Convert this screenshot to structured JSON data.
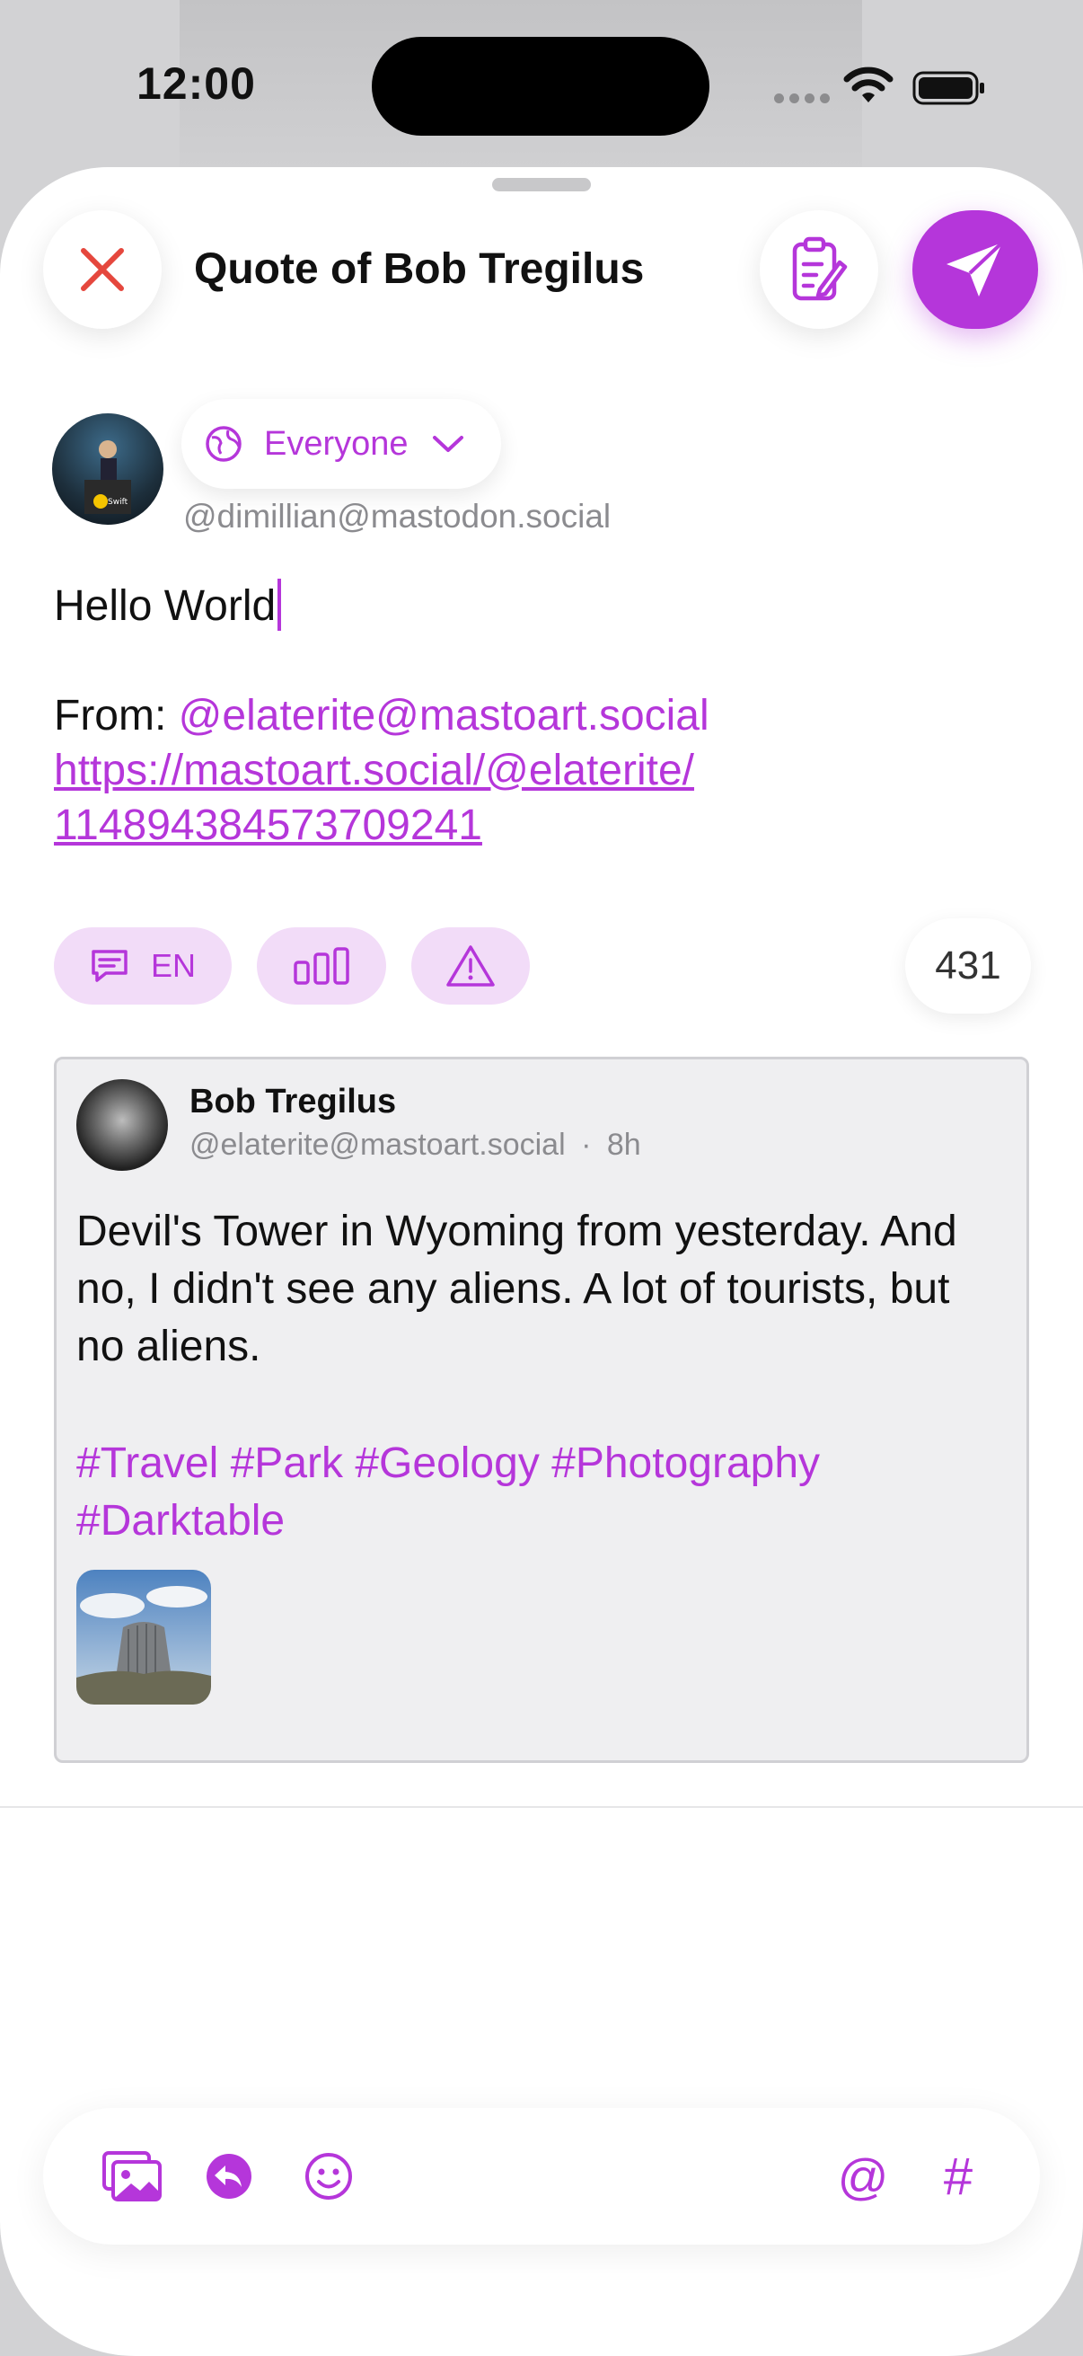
{
  "status_bar": {
    "time": "12:00"
  },
  "header": {
    "title": "Quote of Bob Tregilus",
    "close_icon": "close-icon",
    "drafts_icon": "clipboard-edit-icon",
    "send_icon": "paper-plane-icon"
  },
  "composer": {
    "visibility": "Everyone",
    "account_handle": "@dimillian@mastodon.social",
    "text_line1": "Hello World",
    "from_label": "From: ",
    "from_mention": "@elaterite@mastoart.social",
    "link_line1": "https://mastoart.social/@elaterite/",
    "link_line2": "114894384573709241"
  },
  "chips": {
    "language": "EN",
    "language_icon": "speech-bubble-icon",
    "poll_icon": "poll-bars-icon",
    "content_warning_icon": "warning-triangle-icon",
    "char_count": "431"
  },
  "quoted_post": {
    "author_name": "Bob Tregilus",
    "author_handle": "@elaterite@mastoart.social",
    "separator": "·",
    "time_ago": "8h",
    "body": "Devil's Tower in Wyoming from yesterday. And no, I didn't see any aliens. A lot of tourists, but no aliens.",
    "hashtags_line1": "#Travel #Park #Geology #Photography",
    "hashtags_line2": "#Darktable"
  },
  "toolbar": {
    "icons": [
      "photo-library-icon",
      "reply-icon",
      "emoji-icon",
      "at-mention-icon",
      "hashtag-icon"
    ],
    "at_symbol": "@",
    "hash_symbol": "#"
  },
  "colors": {
    "accent": "#b536da",
    "close_red": "#e5473d",
    "chip_bg": "#f2dcf8"
  }
}
